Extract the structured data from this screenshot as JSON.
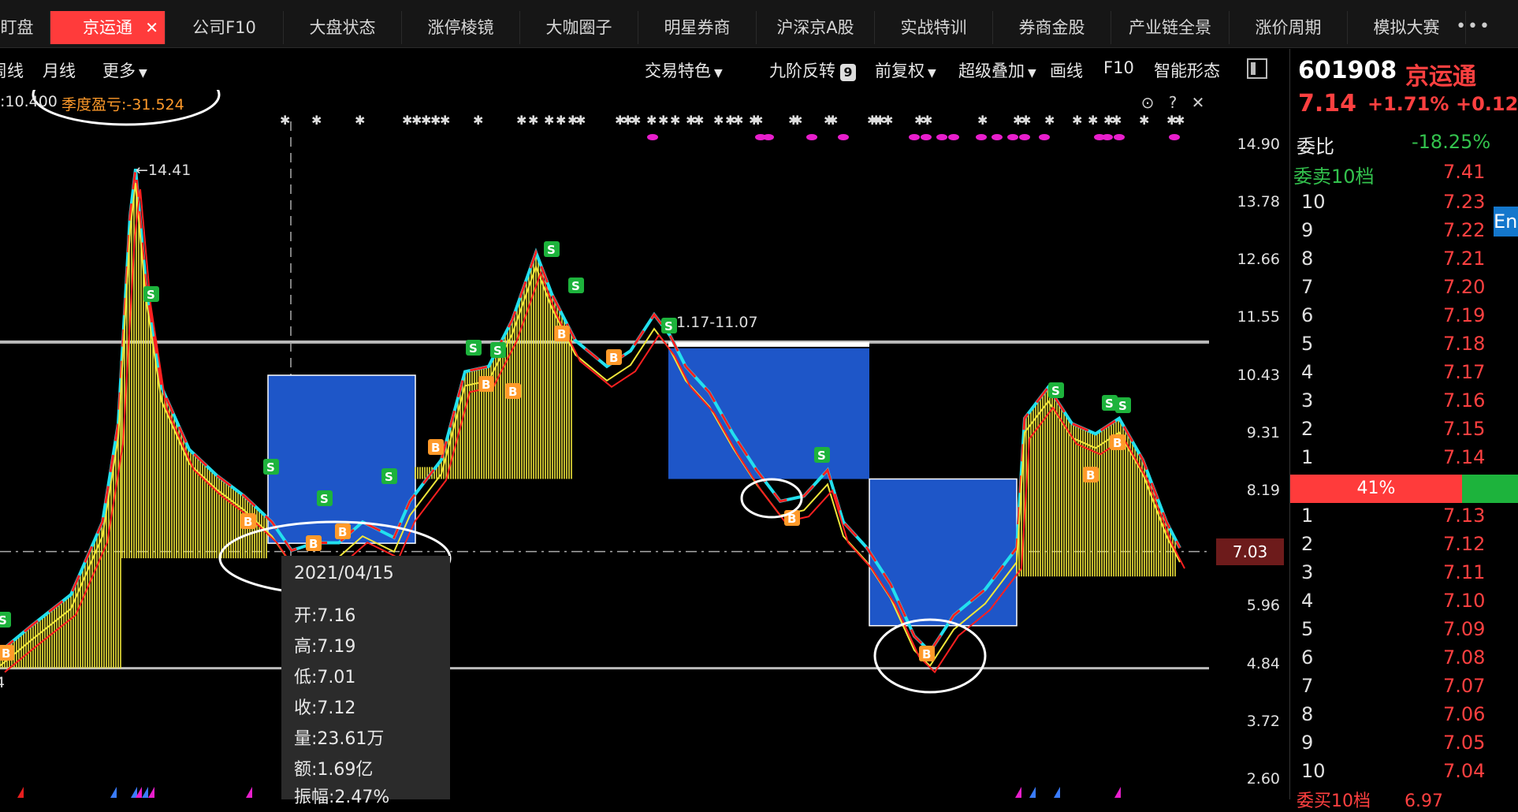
{
  "tabs": [
    {
      "label": "盯盘",
      "active": false
    },
    {
      "label": "京运通",
      "active": true
    },
    {
      "label": "公司F10",
      "active": false
    },
    {
      "label": "大盘状态",
      "active": false
    },
    {
      "label": "涨停棱镜",
      "active": false
    },
    {
      "label": "大咖圈子",
      "active": false
    },
    {
      "label": "明星券商",
      "active": false
    },
    {
      "label": "沪深京A股",
      "active": false
    },
    {
      "label": "实战特训",
      "active": false
    },
    {
      "label": "券商金股",
      "active": false
    },
    {
      "label": "产业链全景",
      "active": false
    },
    {
      "label": "涨价周期",
      "active": false
    },
    {
      "label": "模拟大赛",
      "active": false
    }
  ],
  "tab_close": "✕",
  "tab_more": "•••",
  "toolbar_left": {
    "week": "周线",
    "month": "月线",
    "more": "更多"
  },
  "toolbar_right": {
    "trade_feature": "交易特色",
    "nine_reversal": "九阶反转",
    "nine_badge": "9",
    "fq": "前复权",
    "overlay": "超级叠加",
    "draw": "画线",
    "f10": "F10",
    "smart": "智能形态"
  },
  "chart_header": {
    "ma_text": ":10.400",
    "quarter_loss": "季度盈亏:-31.524"
  },
  "chart_annotations": {
    "high_label": "←14.41",
    "range_label": "1.17-11.07",
    "left_edge_label": "4"
  },
  "axis_labels": [
    "14.90",
    "13.78",
    "12.66",
    "11.55",
    "10.43",
    "9.31",
    "8.19",
    "7.03",
    "5.96",
    "4.84",
    "3.72",
    "2.60"
  ],
  "current_price_tag": "7.03",
  "tooltip": {
    "date": "2021/04/15",
    "rows": [
      {
        "label": "开:",
        "value": "7.16"
      },
      {
        "label": "高:",
        "value": "7.19"
      },
      {
        "label": "低:",
        "value": "7.01"
      },
      {
        "label": "收:",
        "value": "7.12"
      },
      {
        "label": "量:",
        "value": "23.61万"
      },
      {
        "label": "额:",
        "value": "1.69亿"
      },
      {
        "label": "振幅:",
        "value": "2.47%"
      }
    ]
  },
  "orderbook": {
    "code": "601908",
    "name": "京运通",
    "price": "7.14",
    "pct": "+1.71%",
    "chg": "+0.12",
    "ratio_label": "委比",
    "ratio_value": "-18.25%",
    "sell_header": "委卖10档",
    "sell_header_value": "7.41",
    "sells": [
      {
        "idx": "10",
        "price": "7.23"
      },
      {
        "idx": "9",
        "price": "7.22"
      },
      {
        "idx": "8",
        "price": "7.21"
      },
      {
        "idx": "7",
        "price": "7.20"
      },
      {
        "idx": "6",
        "price": "7.19"
      },
      {
        "idx": "5",
        "price": "7.18"
      },
      {
        "idx": "4",
        "price": "7.17"
      },
      {
        "idx": "3",
        "price": "7.16"
      },
      {
        "idx": "2",
        "price": "7.15"
      },
      {
        "idx": "1",
        "price": "7.14"
      }
    ],
    "bar_label": "41%",
    "buys": [
      {
        "idx": "1",
        "price": "7.13"
      },
      {
        "idx": "2",
        "price": "7.12"
      },
      {
        "idx": "3",
        "price": "7.11"
      },
      {
        "idx": "4",
        "price": "7.10"
      },
      {
        "idx": "5",
        "price": "7.09"
      },
      {
        "idx": "6",
        "price": "7.08"
      },
      {
        "idx": "7",
        "price": "7.07"
      },
      {
        "idx": "8",
        "price": "7.06"
      },
      {
        "idx": "9",
        "price": "7.05"
      },
      {
        "idx": "10",
        "price": "7.04"
      }
    ],
    "bottom_label": "委买10档",
    "bottom_value": "6.97",
    "edge_text": "En"
  },
  "colors": {
    "up": "#ff2020",
    "down": "#22e0ee",
    "yellow": "#f0e63a",
    "blue": "#1e56c8",
    "magenta": "#e81ecc",
    "orange": "#ff9a2a"
  }
}
